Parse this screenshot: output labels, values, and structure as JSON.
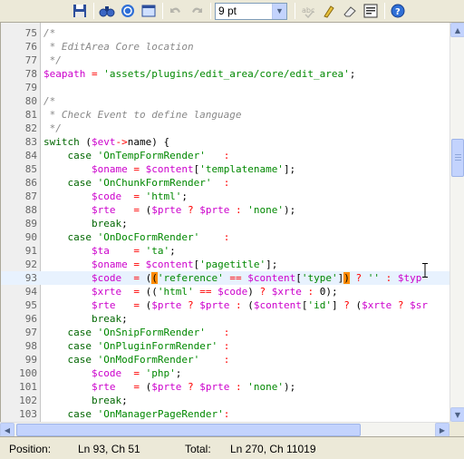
{
  "toolbar": {
    "font_size": "9 pt",
    "buttons": [
      {
        "name": "save-icon",
        "enabled": true
      },
      {
        "name": "search-icon",
        "enabled": true
      },
      {
        "name": "goto-line-icon",
        "enabled": true
      },
      {
        "name": "fullscreen-icon",
        "enabled": true
      },
      {
        "name": "undo-icon",
        "enabled": false
      },
      {
        "name": "redo-icon",
        "enabled": false
      },
      {
        "name": "spellcheck-icon",
        "enabled": false
      },
      {
        "name": "highlight-icon",
        "enabled": true
      },
      {
        "name": "reset-highlight-icon",
        "enabled": true
      },
      {
        "name": "word-wrap-icon",
        "enabled": true
      },
      {
        "name": "help-icon",
        "enabled": true
      }
    ]
  },
  "editor": {
    "current_line": 93,
    "lines": [
      {
        "n": "75",
        "code": "/*"
      },
      {
        "n": "76",
        "code": " * EditArea Core location"
      },
      {
        "n": "77",
        "code": " */"
      },
      {
        "n": "78",
        "code": "$eapath = 'assets/plugins/edit_area/core/edit_area';"
      },
      {
        "n": "79",
        "code": ""
      },
      {
        "n": "80",
        "code": "/*"
      },
      {
        "n": "81",
        "code": " * Check Event to define language"
      },
      {
        "n": "82",
        "code": " */"
      },
      {
        "n": "83",
        "code": "switch ($evt->name) {"
      },
      {
        "n": "84",
        "code": "    case 'OnTempFormRender'   :"
      },
      {
        "n": "85",
        "code": "        $oname = $content['templatename'];"
      },
      {
        "n": "86",
        "code": "    case 'OnChunkFormRender'  :"
      },
      {
        "n": "87",
        "code": "        $code  = 'html';"
      },
      {
        "n": "88",
        "code": "        $rte   = ($prte ? $prte : 'none');"
      },
      {
        "n": "89",
        "code": "        break;"
      },
      {
        "n": "90",
        "code": "    case 'OnDocFormRender'    :"
      },
      {
        "n": "91",
        "code": "        $ta    = 'ta';"
      },
      {
        "n": "92",
        "code": "        $oname = $content['pagetitle'];"
      },
      {
        "n": "93",
        "code": "        $code  = (('reference' == $content['type']) ? '' : $typ"
      },
      {
        "n": "94",
        "code": "        $xrte  = (('html' == $code) ? $xrte : 0);"
      },
      {
        "n": "95",
        "code": "        $rte   = ($prte ? $prte : ($content['id'] ? ($xrte ? $sr"
      },
      {
        "n": "96",
        "code": "        break;"
      },
      {
        "n": "97",
        "code": "    case 'OnSnipFormRender'   :"
      },
      {
        "n": "98",
        "code": "    case 'OnPluginFormRender' :"
      },
      {
        "n": "99",
        "code": "    case 'OnModFormRender'    :"
      },
      {
        "n": "100",
        "code": "        $code  = 'php';"
      },
      {
        "n": "101",
        "code": "        $rte   = ($prte ? $prte : 'none');"
      },
      {
        "n": "102",
        "code": "        break;"
      },
      {
        "n": "103",
        "code": "    case 'OnManagerPageRender':"
      }
    ]
  },
  "status": {
    "position_label": "Position:",
    "position_value": "Ln 93, Ch 51",
    "total_label": "Total:",
    "total_value": "Ln 270, Ch 11019"
  },
  "colors": {
    "comment": "#888888",
    "variable": "#cc00cc",
    "string": "#008800",
    "keyword": "#006600",
    "operator": "#ff0000",
    "bracket_match": "#ff8c00"
  }
}
